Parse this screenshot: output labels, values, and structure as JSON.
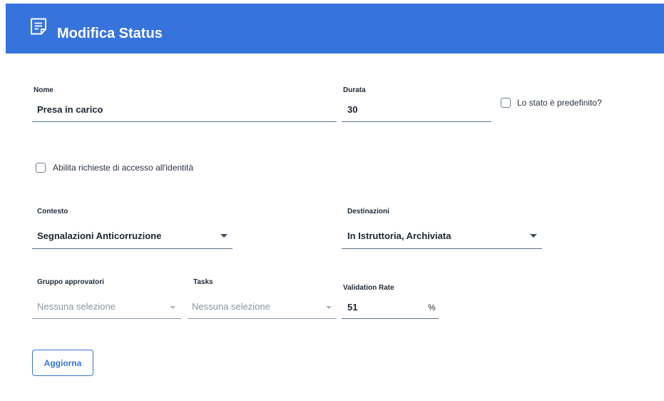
{
  "colors": {
    "accent": "#3673dd"
  },
  "header": {
    "icon": "note-edit-icon",
    "title": "Modifica Status"
  },
  "form": {
    "nome": {
      "label": "Nome",
      "value": "Presa in carico"
    },
    "durata": {
      "label": "Durata",
      "value": "30"
    },
    "predefinito": {
      "label": "Lo stato è predefinito?",
      "checked": false
    },
    "abilita_richieste": {
      "label": "Abilita richieste di accesso all'identità",
      "checked": false
    },
    "contesto": {
      "label": "Contesto",
      "value": "Segnalazioni Anticorruzione"
    },
    "destinazioni": {
      "label": "Destinazioni",
      "value": "In Istruttoria, Archiviata"
    },
    "gruppo_approvatori": {
      "label": "Gruppo approvatori",
      "placeholder": "Nessuna selezione"
    },
    "tasks": {
      "label": "Tasks",
      "placeholder": "Nessuna selezione"
    },
    "validation_rate": {
      "label": "Validation Rate",
      "value": "51",
      "unit": "%"
    }
  },
  "actions": {
    "update_label": "Aggiorna"
  }
}
